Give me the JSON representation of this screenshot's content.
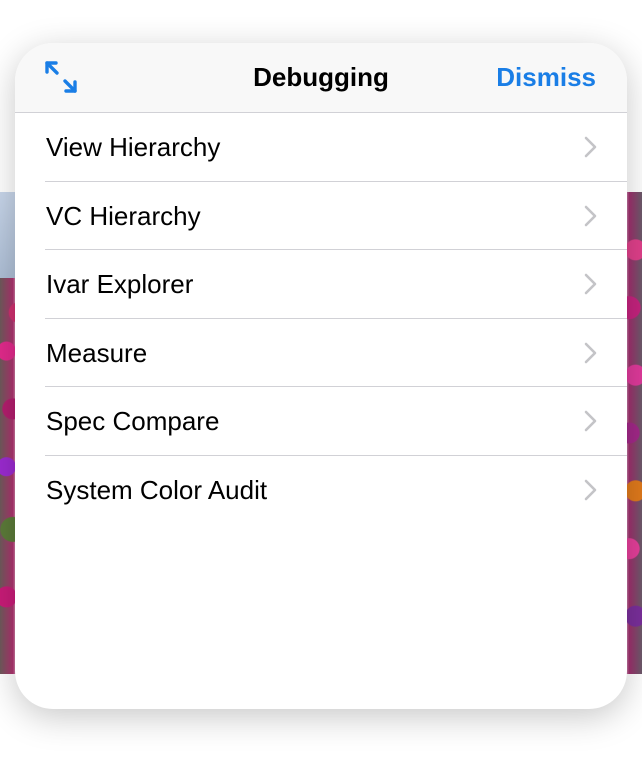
{
  "navbar": {
    "title": "Debugging",
    "dismiss_label": "Dismiss",
    "expand_icon": "expand-arrows-icon"
  },
  "menu": {
    "items": [
      {
        "label": "View Hierarchy"
      },
      {
        "label": "VC Hierarchy"
      },
      {
        "label": "Ivar Explorer"
      },
      {
        "label": "Measure"
      },
      {
        "label": "Spec Compare"
      },
      {
        "label": "System Color Audit"
      }
    ],
    "chevron_icon": "chevron-right-icon"
  },
  "colors": {
    "accent": "#1a7ee6",
    "separator": "#d1d1d6",
    "chevron": "#c4c4c7",
    "navbar_bg": "#f8f8f8"
  }
}
